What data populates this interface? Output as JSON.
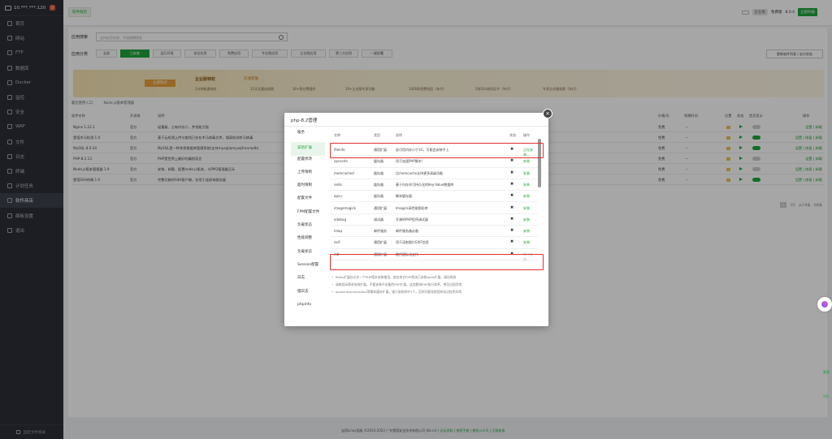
{
  "sidebar": {
    "ip": "10.***.***.120",
    "badge": "0",
    "items": [
      "首页",
      "网站",
      "FTP",
      "数据库",
      "Docker",
      "监控",
      "安全",
      "WAF",
      "文件",
      "日志",
      "终端",
      "计划任务",
      "软件商店",
      "面板设置",
      "退出"
    ],
    "active_index": 12,
    "footer": "固定文件目录"
  },
  "topbar": {
    "tab": "软件商店",
    "pro_tag": "企业版",
    "version_label": "免费版",
    "version": "8.0.4",
    "upgrade": "立即升级"
  },
  "search": {
    "label": "应用搜索",
    "placeholder": "支持应用名称、字段模糊搜索"
  },
  "category": {
    "label": "应用分类",
    "items": [
      "全部",
      "已安装",
      "运行环境",
      "安全应用",
      "免费应用",
      "专业版应用",
      "企业版应用",
      "第三方应用",
      "一键部署"
    ],
    "active_index": 1,
    "update_btn": "更新软件列表 / 支付状态"
  },
  "banner": {
    "button": "立即购买",
    "title": "企业版特权",
    "online": "在线客服",
    "features": [
      "1分钟极速响应",
      "15天无理由退款",
      "30+款付费插件",
      "20+企业版专享功能",
      "1000条免费短信（年付）",
      "2张SSL商用证书（年付）",
      "专享企业服务群（年付）"
    ]
  },
  "plugin_entry": {
    "prefix": "最近使用入口：",
    "item": "Node.js版本管理器"
  },
  "table": {
    "headers": [
      "软件名称",
      "开发商",
      "说明",
      "价格/天",
      "到期时间",
      "位置",
      "状态",
      "首页显示",
      "操作"
    ],
    "rows": [
      {
        "name": "Nginx 1.22.1",
        "dev": "官方",
        "desc": "轻量级、占有内存少，并发能力强",
        "price": "免费",
        "exp": "--",
        "home": false,
        "ops": "设置 | 卸载"
      },
      {
        "name": "堡塔木马检测 1.0",
        "dev": "官方",
        "desc": "基于云检测上传与查找已存在木马病毒文件，隔离检测木马病毒",
        "price": "免费",
        "exp": "--",
        "home": true,
        "ops": "设置 | 修复 | 卸载"
      },
      {
        "name": "MySQL 8.0.34",
        "dev": "官方",
        "desc": "MySQL是一种关系数据库管理系统(支持mysql/pmysql/mariadb)",
        "price": "免费",
        "exp": "--",
        "home": true,
        "ops": "设置 | 修复 | 卸载"
      },
      {
        "name": "PHP-8.2.13",
        "dev": "官方",
        "desc": "PHP是世界上最好的编程语言",
        "price": "免费",
        "exp": "--",
        "home": false,
        "ops": "设置 | 卸载"
      },
      {
        "name": "Node.js版本管理器 1.9",
        "dev": "官方",
        "desc": "安装、卸载、配置node.js版本，与PM2管理器互斥",
        "price": "免费",
        "exp": "--",
        "home": false,
        "ops": "设置 | 修复 | 卸载"
      },
      {
        "name": "堡塔SSH终端 1.0",
        "dev": "官方",
        "desc": "完整功能的SSH客户端，仅用于连接本服务器",
        "price": "免费",
        "exp": "--",
        "home": true,
        "ops": "设置 | 修复 | 卸载"
      }
    ],
    "pager": {
      "current": "1",
      "total": "1/1",
      "range": "从1-6条",
      "count": "共6条"
    }
  },
  "modal": {
    "title": "php-8.2管理",
    "nav": [
      "服务",
      "安装扩展",
      "配置修改",
      "上传限制",
      "超时限制",
      "配置文件",
      "FPM配置文件",
      "负载状态",
      "性能调整",
      "负载状态",
      "Session配置",
      "日志",
      "慢日志",
      "phpinfo"
    ],
    "nav_active": 1,
    "ext_headers": [
      "名称",
      "类型",
      "说明",
      "状态",
      "操作"
    ],
    "extensions": [
      {
        "name": "fileinfo",
        "type": "通用扩展",
        "desc": "若可用内存小于1G，可能会安装不上",
        "status": "✖",
        "op": "正在安装..."
      },
      {
        "name": "opcache",
        "type": "缓存器",
        "desc": "用于加速PHP脚本!",
        "status": "✖",
        "op": "安装"
      },
      {
        "name": "memcached",
        "type": "缓存器",
        "desc": "比memcache支持更多高级功能",
        "status": "✖",
        "op": "安装"
      },
      {
        "name": "redis",
        "type": "缓存器",
        "desc": "基于内存亦可持久化的Key-Value数据库",
        "status": "✖",
        "op": "安装"
      },
      {
        "name": "apcu",
        "type": "缓存器",
        "desc": "脚本缓存器",
        "status": "✖",
        "op": "安装"
      },
      {
        "name": "imagemagick",
        "type": "通用扩展",
        "desc": "Imagick高性能图形库",
        "status": "✖",
        "op": "安装"
      },
      {
        "name": "xdebug",
        "type": "调试器",
        "desc": "开源的PHP程序调试器",
        "status": "✖",
        "op": "安装"
      },
      {
        "name": "imap",
        "type": "邮件服务",
        "desc": "邮件服务器必备",
        "status": "✖",
        "op": "安装"
      },
      {
        "name": "exif",
        "type": "通用扩展",
        "desc": "用于读取图片EXIF信息",
        "status": "✖",
        "op": "安装"
      },
      {
        "name": "intl",
        "type": "通用扩展",
        "desc": "提供国际化支持",
        "status": "✖",
        "op": "等待安装..."
      }
    ],
    "notes": [
      "Redis扩展仅允许一个PHP版本安装使用，若在其它PHP版本已安装redis扩展，请勿再装",
      "请按实际需求安装扩展，不要安装不必要的PHP扩展，这会影响PHP执行效率，甚至出现异常",
      "opcache/xcache/apc等脚本缓存扩展，请只安装其中1个，否则可能导致您的站点程序异常"
    ]
  },
  "footer": {
    "text": "宝塔Linux面板 ©2014-2023 广东堡塔安全技术有限公司 (bt.cn)",
    "links": [
      "论坛求助",
      "使用手册",
      "微信公众号",
      "正版查询"
    ]
  },
  "right_float": {
    "kefu": "客服",
    "pingjia": "评价"
  }
}
